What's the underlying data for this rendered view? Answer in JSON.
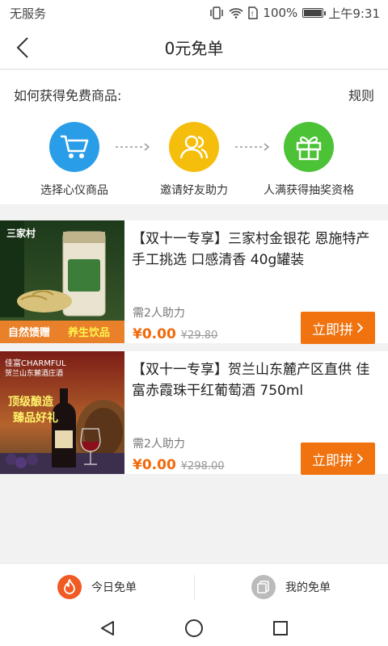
{
  "status_bar": {
    "carrier": "无服务",
    "battery": "100%",
    "time": "上午9:31"
  },
  "header": {
    "title": "0元免单"
  },
  "how": {
    "label": "如何获得免费商品:",
    "rules": "规则",
    "steps": [
      {
        "label": "选择心仪商品",
        "icon": "cart-icon",
        "color": "#2a9de8"
      },
      {
        "label": "邀请好友助力",
        "icon": "people-icon",
        "color": "#f5be0c"
      },
      {
        "label": "人满获得抽奖资格",
        "icon": "gift-icon",
        "color": "#4cc236"
      }
    ]
  },
  "products": [
    {
      "title": "【双十一专享】三家村金银花 恩施特产 手工挑选 口感清香 40g罐装",
      "need": "需2人助力",
      "price": "¥0.00",
      "orig_price": "¥29.80",
      "button": "立即拼",
      "img_text": {
        "brand": "三家村",
        "banner_left": "自然馈赠",
        "banner_right": "养生饮品"
      }
    },
    {
      "title": "【双十一专享】贺兰山东麓产区直供 佳富赤霞珠干红葡萄酒 750ml",
      "need": "需2人助力",
      "price": "¥0.00",
      "orig_price": "¥298.00",
      "button": "立即拼",
      "img_text": {
        "brand": "佳富CHARMFUL",
        "sub": "贺兰山东麓酒庄酒",
        "slogan1": "顶级酿造",
        "slogan2": "臻品好礼"
      }
    }
  ],
  "tabs": [
    {
      "label": "今日免单",
      "icon": "flame-icon",
      "color": "#f05a23"
    },
    {
      "label": "我的免单",
      "icon": "copy-icon",
      "color": "#bbbbbb"
    }
  ],
  "colors": {
    "accent": "#f07310",
    "price": "#f06a0b"
  }
}
